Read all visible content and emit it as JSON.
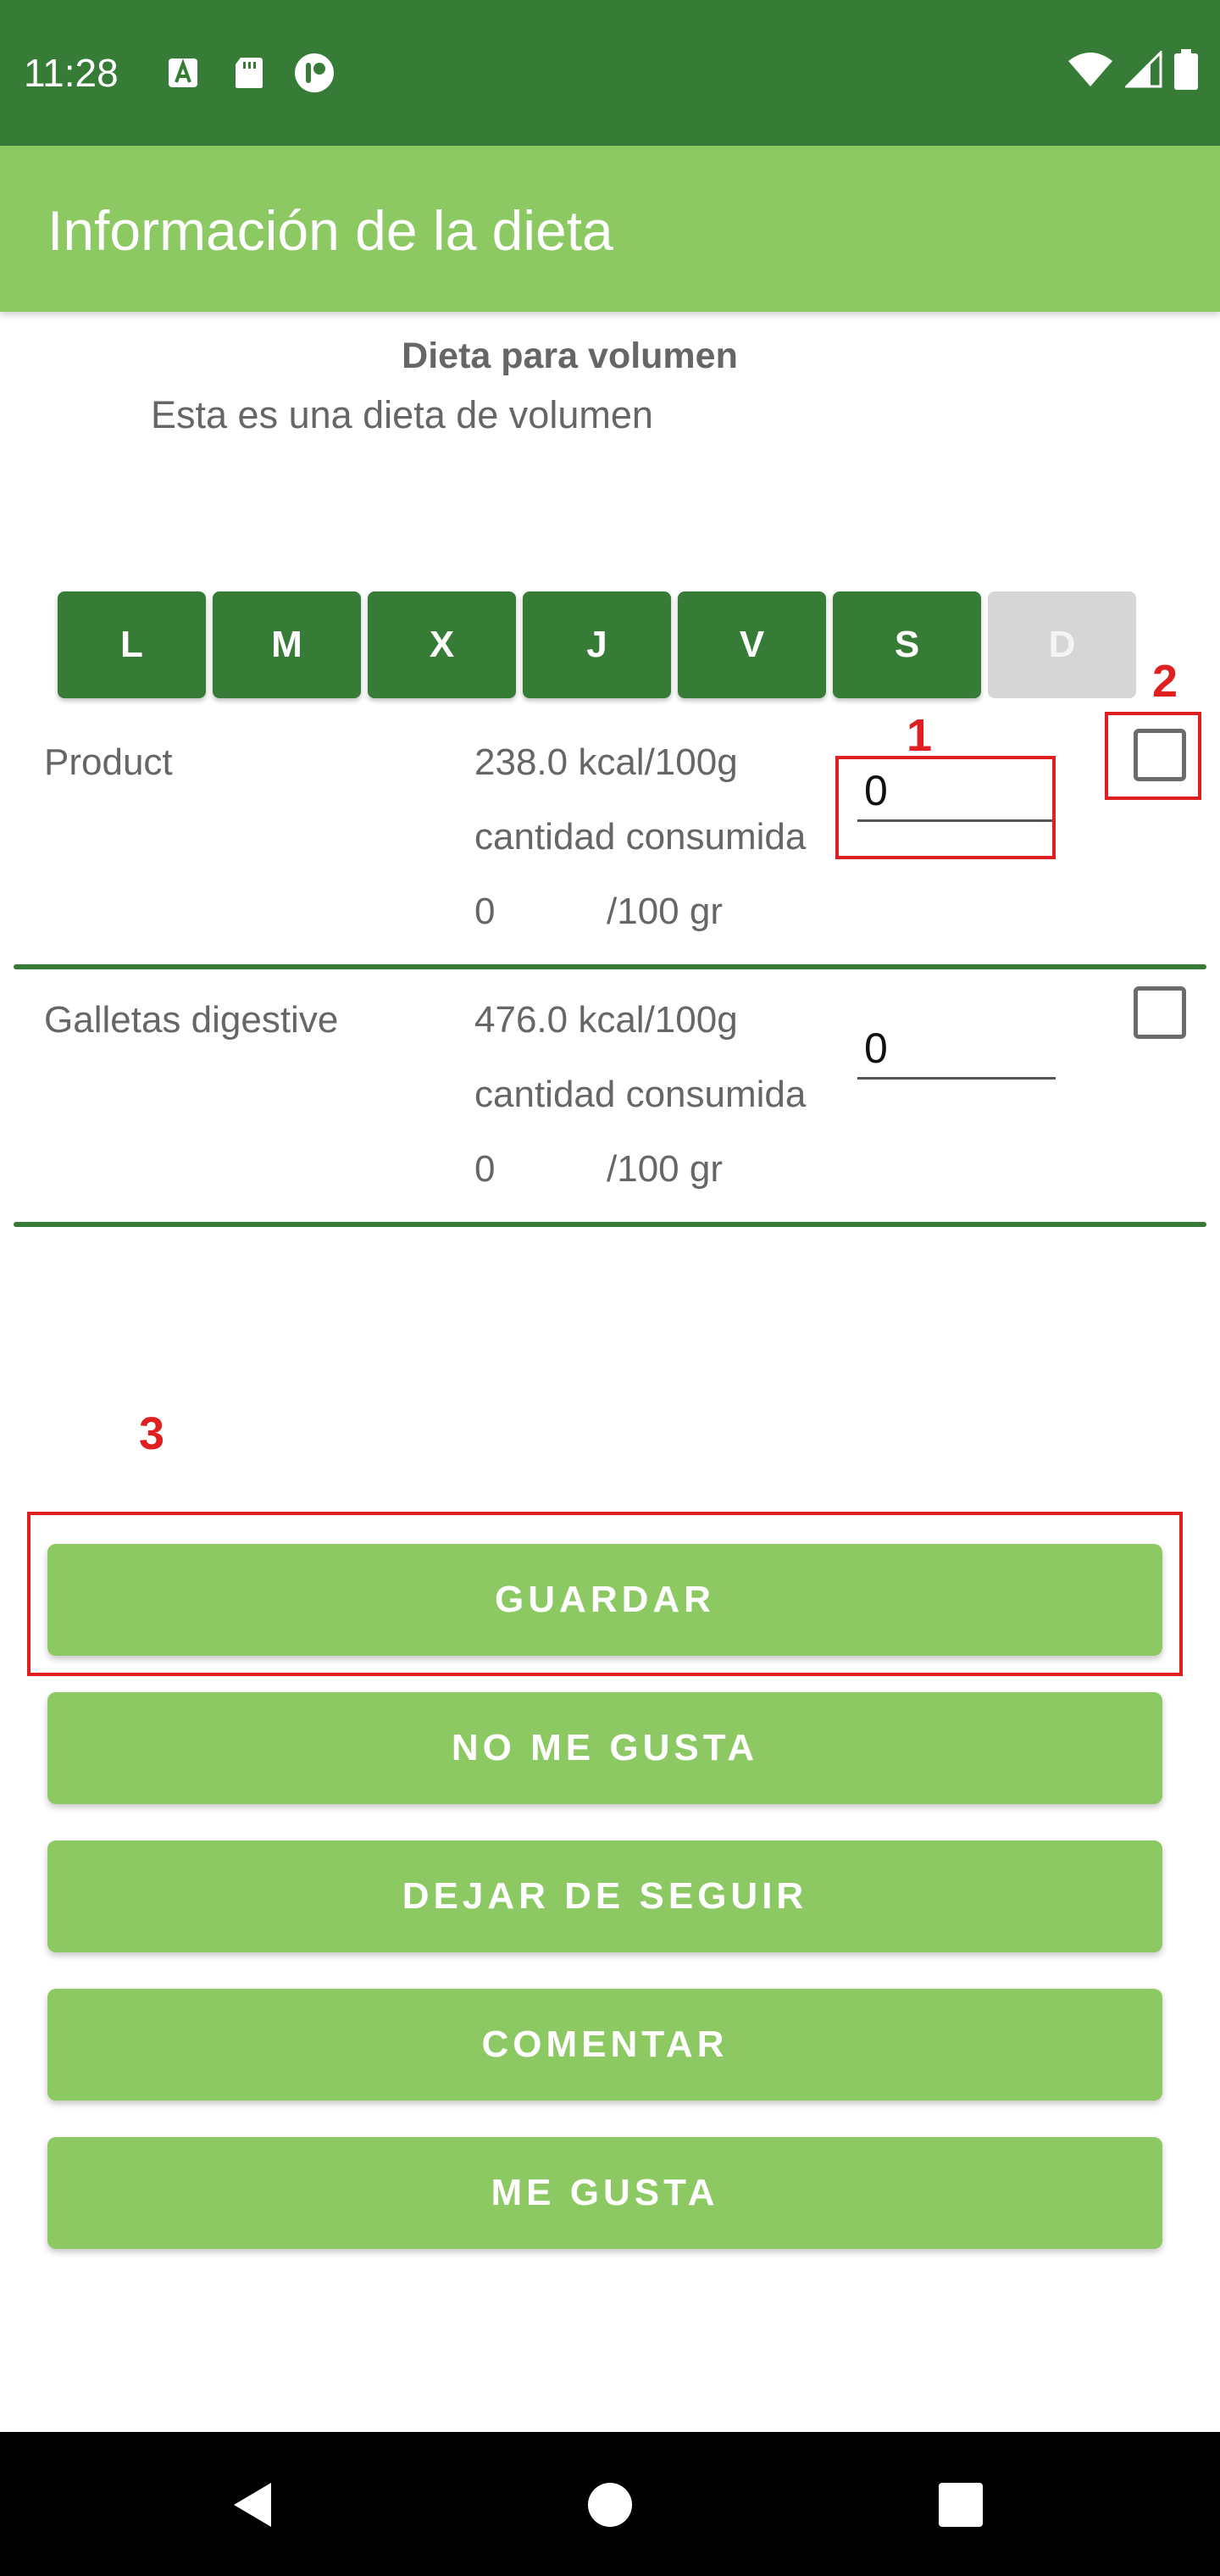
{
  "status_bar": {
    "time": "11:28",
    "left_icons": [
      "text-a-icon",
      "sd-card-icon",
      "notification-app-icon"
    ],
    "right_icons": [
      "wifi-icon",
      "cell-signal-icon",
      "battery-icon"
    ]
  },
  "app_bar": {
    "title": "Información de la dieta"
  },
  "diet": {
    "name": "Dieta para volumen",
    "description": "Esta es una dieta de volumen"
  },
  "days": [
    {
      "label": "L",
      "enabled": true
    },
    {
      "label": "M",
      "enabled": true
    },
    {
      "label": "X",
      "enabled": true
    },
    {
      "label": "J",
      "enabled": true
    },
    {
      "label": "V",
      "enabled": true
    },
    {
      "label": "S",
      "enabled": true
    },
    {
      "label": "D",
      "enabled": false
    }
  ],
  "foods": [
    {
      "name": "Product",
      "kcal": "238.0 kcal/100g",
      "consumed_label": "cantidad consumida",
      "amount": "0",
      "per_unit": "/100 gr",
      "quantity_value": "0",
      "checked": false
    },
    {
      "name": "Galletas digestive",
      "kcal": "476.0 kcal/100g",
      "consumed_label": "cantidad consumida",
      "amount": "0",
      "per_unit": "/100 gr",
      "quantity_value": "0",
      "checked": false
    }
  ],
  "annotations": [
    "1",
    "2",
    "3"
  ],
  "actions": {
    "save": "GUARDAR",
    "dislike": "NO ME GUSTA",
    "unfollow": "DEJAR DE SEGUIR",
    "comment": "COMENTAR",
    "like": "ME GUSTA"
  },
  "colors": {
    "status_bar": "#367c36",
    "app_bar": "#8cc962",
    "day_button": "#367c36",
    "day_button_disabled": "#d6d6d6",
    "action_button": "#8cc962",
    "annotation": "#e02020"
  },
  "nav_bar": {
    "icons": [
      "back-icon",
      "home-icon",
      "recents-icon"
    ]
  }
}
